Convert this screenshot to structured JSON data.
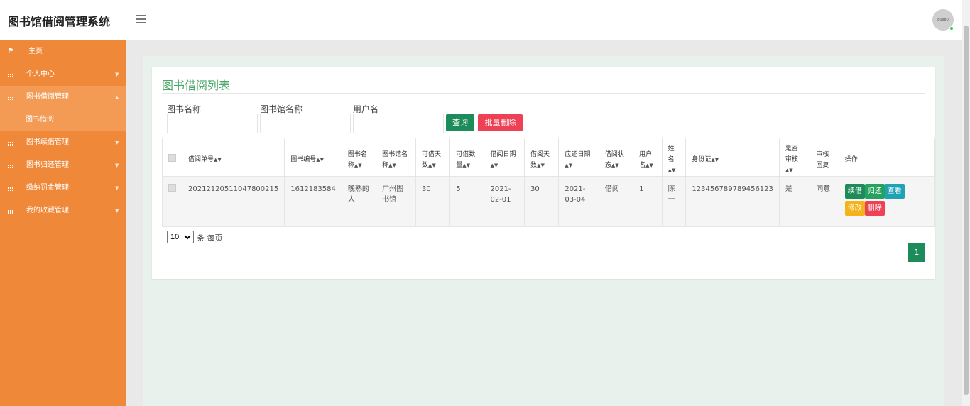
{
  "header": {
    "brand": "图书馆借阅管理系统",
    "avatar_text": "80x80"
  },
  "sidebar": {
    "items": [
      {
        "label": "主页",
        "icon": "flag-icon"
      },
      {
        "label": "个人中心",
        "icon": "grid-icon"
      },
      {
        "label": "图书借阅管理",
        "icon": "grid-icon",
        "expanded": true
      },
      {
        "label": "图书续借管理",
        "icon": "grid-icon"
      },
      {
        "label": "图书归还管理",
        "icon": "grid-icon"
      },
      {
        "label": "缴纳罚金管理",
        "icon": "grid-icon"
      },
      {
        "label": "我的收藏管理",
        "icon": "grid-icon"
      }
    ],
    "subitem": "图书借阅"
  },
  "panel": {
    "title": "图书借阅列表",
    "filters": {
      "book_name_label": "图书名称",
      "library_name_label": "图书馆名称",
      "username_label": "用户名"
    },
    "search_button": "查询",
    "bulk_delete_button": "批量删除"
  },
  "table": {
    "headers": [
      "借阅单号",
      "图书编号",
      "图书名称",
      "图书馆名称",
      "可借天数",
      "可借数量",
      "借阅日期",
      "借阅天数",
      "应还日期",
      "借阅状态",
      "用户名",
      "姓名",
      "身份证",
      "是否审核",
      "审核回复",
      "操作"
    ],
    "rows": [
      {
        "order_no": "20212120511047800215",
        "book_no": "1612183584",
        "book_name": "晚熟的人",
        "library": "广州图书馆",
        "borrow_days_allowed": "30",
        "borrow_qty": "5",
        "borrow_date": "2021-02-01",
        "borrow_days": "30",
        "due_date": "2021-03-04",
        "status": "借阅",
        "username": "1",
        "name": "陈一",
        "id_card": "123456789789456123",
        "reviewed": "是",
        "review_reply": "同意",
        "actions": {
          "renew": "续借",
          "return": "归还",
          "view": "查看",
          "edit": "修改",
          "delete": "删除"
        }
      }
    ]
  },
  "pagination": {
    "page_size": "10",
    "page_size_label": "条 每页",
    "current_page": "1"
  },
  "colors": {
    "sidebar": "#f0883a",
    "accent_green": "#1e8c5a",
    "danger": "#ee4155",
    "title_green": "#4aa86a"
  }
}
